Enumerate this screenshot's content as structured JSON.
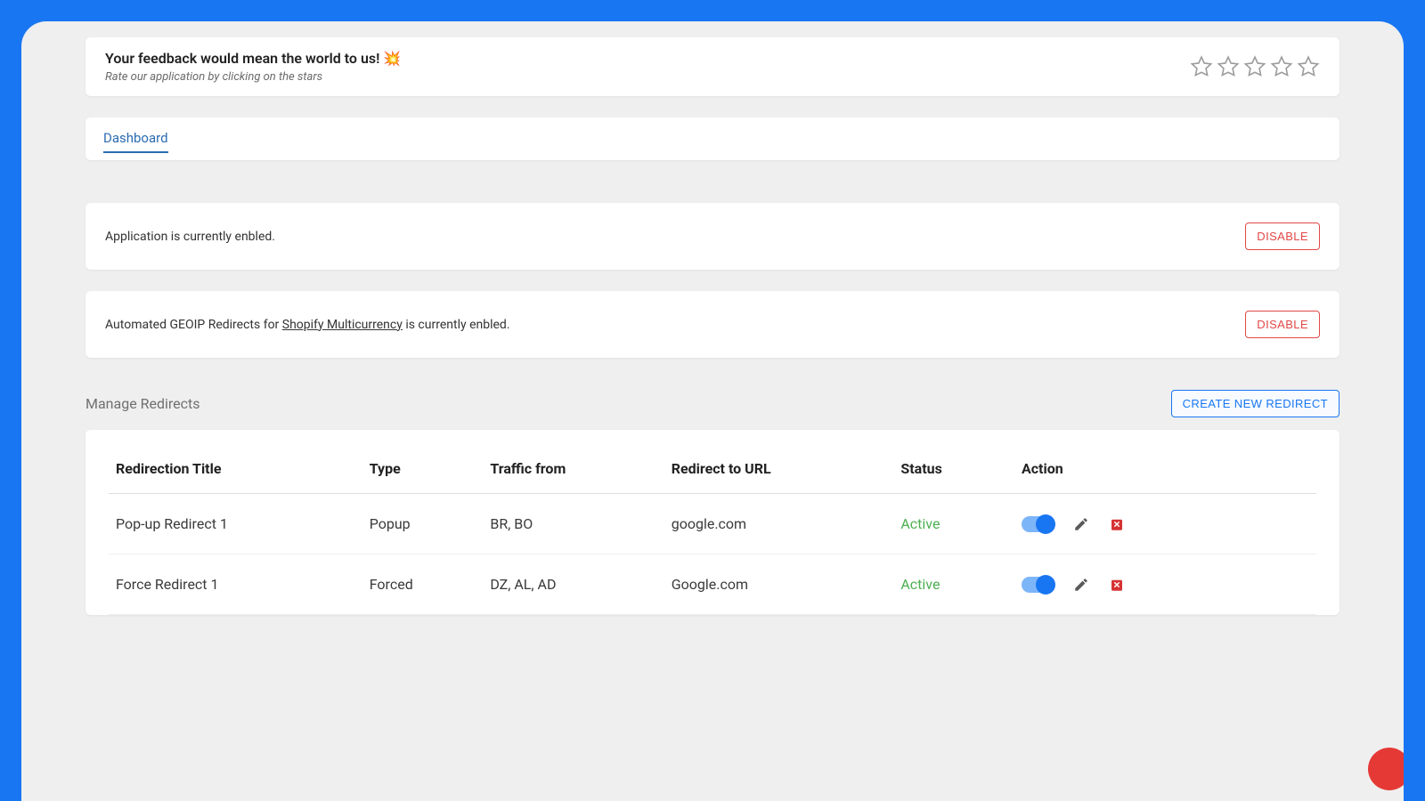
{
  "feedback": {
    "title": "Your feedback would mean the world to us! 💥",
    "subtitle": "Rate our application by clicking on the stars"
  },
  "tabs": {
    "dashboard": "Dashboard"
  },
  "status": {
    "app_enabled": "Application is currently enbled.",
    "geoip_prefix": "Automated GEOIP Redirects for ",
    "geoip_link": "Shopify Multicurrency",
    "geoip_suffix": " is currently enbled.",
    "disable_label": "DISABLE"
  },
  "mgmt": {
    "title": "Manage Redirects",
    "create_label": "CREATE NEW REDIRECT"
  },
  "table": {
    "headers": {
      "title": "Redirection Title",
      "type": "Type",
      "from": "Traffic from",
      "to": "Redirect to URL",
      "status": "Status",
      "action": "Action"
    },
    "rows": [
      {
        "title": "Pop-up Redirect 1",
        "type": "Popup",
        "from": "BR, BO",
        "to": "google.com",
        "status": "Active"
      },
      {
        "title": "Force Redirect 1",
        "type": "Forced",
        "from": "DZ, AL, AD",
        "to": "Google.com",
        "status": "Active"
      }
    ]
  }
}
